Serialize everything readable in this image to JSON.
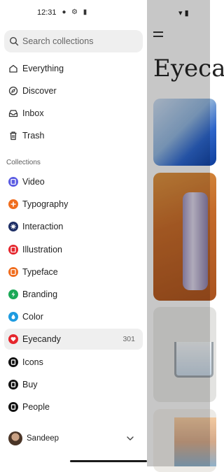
{
  "status_bar": {
    "time": "12:31"
  },
  "search": {
    "placeholder": "Search collections"
  },
  "nav": [
    {
      "label": "Everything",
      "icon": "home-icon"
    },
    {
      "label": "Discover",
      "icon": "compass-icon"
    },
    {
      "label": "Inbox",
      "icon": "inbox-icon"
    },
    {
      "label": "Trash",
      "icon": "trash-icon"
    }
  ],
  "collections_header": "Collections",
  "collections": [
    {
      "label": "Video",
      "color": "#5b5ce2"
    },
    {
      "label": "Typography",
      "color": "#f06d1e"
    },
    {
      "label": "Interaction",
      "color": "#1e2f66"
    },
    {
      "label": "Illustration",
      "color": "#e5262d"
    },
    {
      "label": "Typeface",
      "color": "#f06d1e"
    },
    {
      "label": "Branding",
      "color": "#1aa957"
    },
    {
      "label": "Color",
      "color": "#1e9be0"
    },
    {
      "label": "Eyecandy",
      "color": "#e5262d",
      "count": "301",
      "active": true
    },
    {
      "label": "Icons",
      "color": "#111111"
    },
    {
      "label": "Buy",
      "color": "#111111"
    },
    {
      "label": "People",
      "color": "#111111"
    }
  ],
  "user": {
    "name": "Sandeep"
  },
  "background_page": {
    "title": "Eyeca"
  }
}
